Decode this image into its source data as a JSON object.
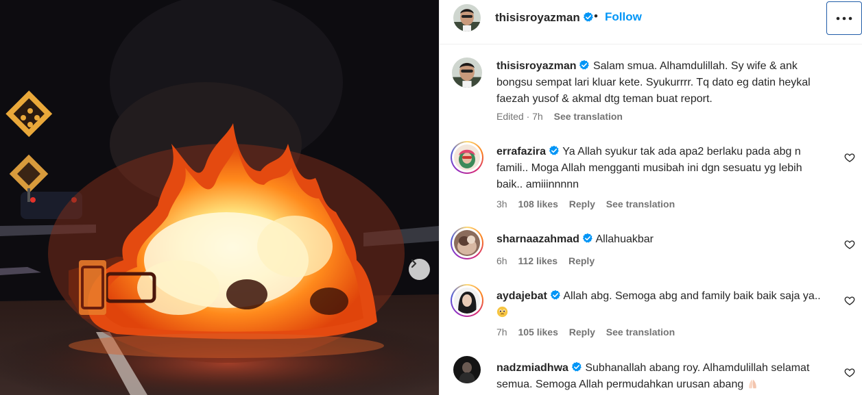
{
  "media": {
    "next_icon": "chevron-right-icon"
  },
  "post": {
    "author": "thisisroyazman",
    "dot": "•",
    "follow_label": "Follow",
    "more_icon": "more-horizontal-icon"
  },
  "caption": {
    "username": "thisisroyazman",
    "text": "Salam smua. Alhamdulillah. Sy wife & ank bongsu sempat lari kluar kete. Syukurrrr. Tq dato eg datin heykal faezah yusof & akmal dtg teman buat report.",
    "edited": "Edited · 7h",
    "translate": "See translation"
  },
  "comments": [
    {
      "username": "errafazira",
      "text": "Ya Allah syukur tak ada apa2 berlaku pada abg n famili.. Moga Allah mengganti musibah ini dgn sesuatu yg lebih baik.. amiiinnnnn",
      "time": "3h",
      "likes": "108 likes",
      "reply": "Reply",
      "translate": "See translation"
    },
    {
      "username": "sharnaazahmad",
      "text": "Allahuakbar",
      "time": "6h",
      "likes": "112 likes",
      "reply": "Reply"
    },
    {
      "username": "aydajebat",
      "text": "Allah abg. Semoga abg and family baik baik saja ya..",
      "emoji": "pleading-face-emoji",
      "time": "7h",
      "likes": "105 likes",
      "reply": "Reply",
      "translate": "See translation"
    },
    {
      "username": "nadzmiadhwa",
      "text": "Subhanallah abang roy. Alhamdulillah selamat semua. Semoga Allah permudahkan urusan abang",
      "emoji": "praying-hands-emoji"
    }
  ],
  "colors": {
    "link_blue": "#0095f6",
    "verified_blue": "#0095f6",
    "meta_gray": "#737373",
    "text": "#262626"
  }
}
